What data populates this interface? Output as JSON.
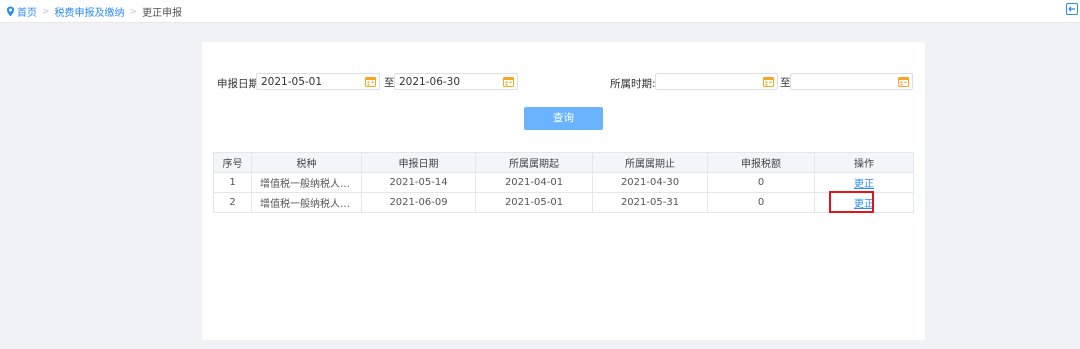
{
  "breadcrumb": {
    "home": "首页",
    "separator": ">",
    "level1": "税费申报及缴纳",
    "current": "更正申报"
  },
  "icons": {
    "location": "location-pin-icon",
    "exit": "exit-icon",
    "calendar": "calendar-icon"
  },
  "colors": {
    "accent": "#2d8cf0",
    "button": "#69b3ff",
    "highlight": "#e4141d",
    "calendar": "#f5a623"
  },
  "filters": {
    "declare_date_label": "申报日期:",
    "declare_date_from": "2021-05-01",
    "declare_date_to": "2021-06-30",
    "to_label": "至",
    "period_label": "所属时期:",
    "period_from": "",
    "period_to": ""
  },
  "query_button": "查询",
  "table": {
    "headers": [
      "序号",
      "税种",
      "申报日期",
      "所属属期起",
      "所属属期止",
      "申报税额",
      "操作"
    ],
    "rows": [
      {
        "no": "1",
        "tax": "增值税一般纳税人申报...",
        "date": "2021-05-14",
        "start": "2021-04-01",
        "end": "2021-04-30",
        "amount": "0",
        "action": "更正"
      },
      {
        "no": "2",
        "tax": "增值税一般纳税人申报...",
        "date": "2021-06-09",
        "start": "2021-05-01",
        "end": "2021-05-31",
        "amount": "0",
        "action": "更正"
      }
    ]
  }
}
